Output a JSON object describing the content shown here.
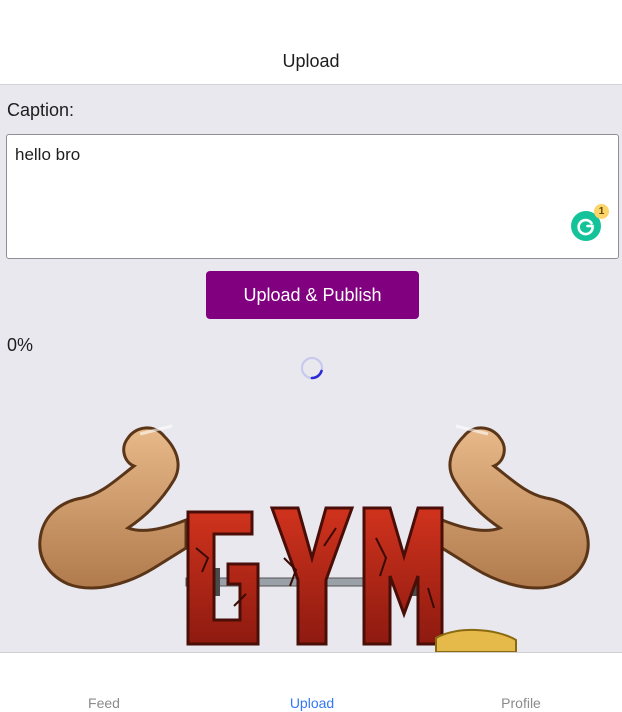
{
  "header": {
    "title": "Upload"
  },
  "form": {
    "caption_label": "Caption:",
    "caption_value": "hello bro",
    "grammarly_count": "1",
    "upload_button": "Upload & Publish",
    "progress_text": "0%"
  },
  "preview": {
    "image_text": "GYM",
    "icon": "bodybuilder-gym-logo"
  },
  "tabs": [
    {
      "label": "Feed",
      "active": false
    },
    {
      "label": "Upload",
      "active": true
    },
    {
      "label": "Profile",
      "active": false
    }
  ],
  "colors": {
    "accent_button": "#800080",
    "active_tab": "#3478f6",
    "inactive_tab": "#8b8b8b",
    "spinner": "#2b2bd6",
    "background": "#e9e8ef"
  }
}
